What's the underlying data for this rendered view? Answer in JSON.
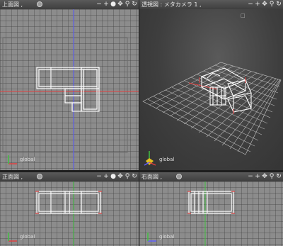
{
  "viewports": {
    "top": {
      "title": "上面図",
      "suffix": ",",
      "axis_label": "global"
    },
    "persp": {
      "title": "透視図 : メタカメラ 1",
      "suffix": ",",
      "axis_label": "global"
    },
    "front": {
      "title": "正面図",
      "suffix": ",",
      "axis_label": "global"
    },
    "right": {
      "title": "右面図",
      "suffix": ",",
      "axis_label": "global"
    }
  },
  "toolbar_icons": [
    "minus-icon",
    "plus-icon",
    "camera-icon",
    "hand-icon",
    "zoom-icon",
    "rotate-icon"
  ],
  "persp_corner": "□",
  "colors": {
    "grid_bg": "#8c8c8c",
    "persp_bg": "#3e3e3e",
    "x_axis": "#e04040",
    "y_axis": "#40c040",
    "z_axis": "#6060ff",
    "wire": "#ffffff"
  }
}
